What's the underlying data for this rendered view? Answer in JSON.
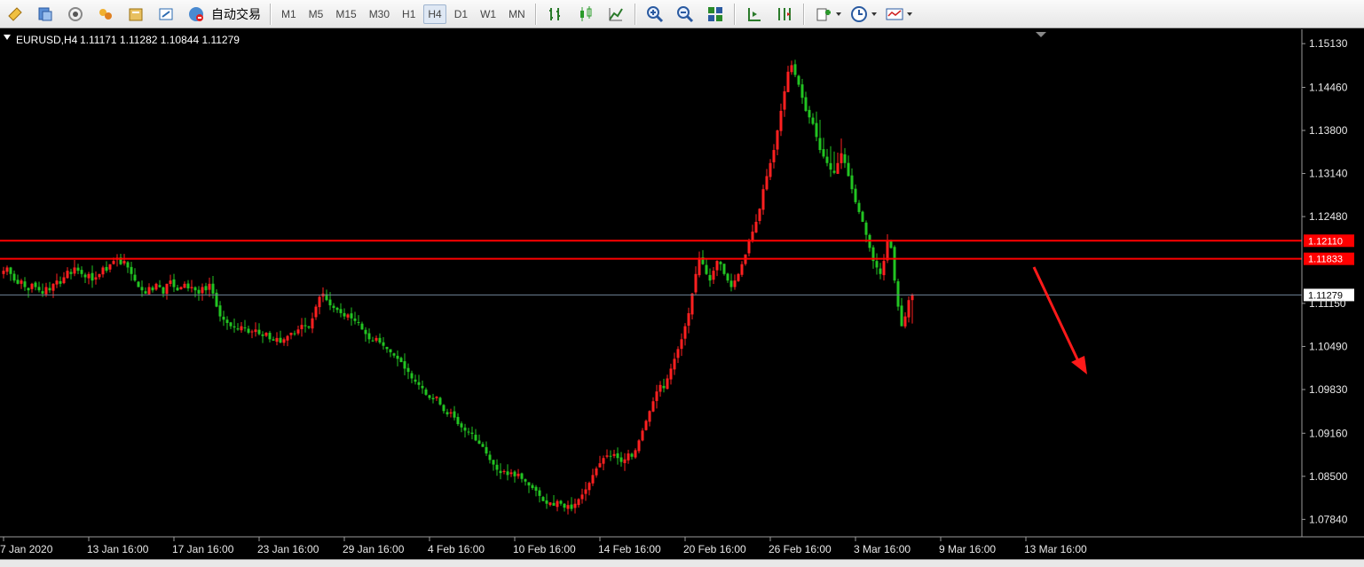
{
  "toolbar": {
    "auto_trade_label": "自动交易",
    "timeframes": [
      "M1",
      "M5",
      "M15",
      "M30",
      "H1",
      "H4",
      "D1",
      "W1",
      "MN"
    ],
    "active_timeframe": "H4"
  },
  "chart_data": {
    "type": "candlestick",
    "symbol": "EURUSD,H4",
    "ohlc_header": "1.11171 1.11282 1.10844 1.11279",
    "y_ticks": [
      1.1513,
      1.1446,
      1.138,
      1.1314,
      1.1248,
      1.1115,
      1.1049,
      1.0983,
      1.0916,
      1.085,
      1.0784
    ],
    "y_tick_labels": [
      "1.15130",
      "1.14460",
      "1.13800",
      "1.13140",
      "1.12480",
      "1.11150",
      "1.10490",
      "1.09830",
      "1.09160",
      "1.08500",
      "1.07840"
    ],
    "ylim": [
      1.076,
      1.1535
    ],
    "x_tick_labels": [
      "7 Jan 2020",
      "13 Jan 16:00",
      "17 Jan 16:00",
      "23 Jan 16:00",
      "29 Jan 16:00",
      "4 Feb 16:00",
      "10 Feb 16:00",
      "14 Feb 16:00",
      "20 Feb 16:00",
      "26 Feb 16:00",
      "3 Mar 16:00",
      "9 Mar 16:00",
      "13 Mar 16:00"
    ],
    "x_tick_bar_index": [
      0,
      24,
      48,
      72,
      96,
      120,
      144,
      168,
      192,
      216,
      240,
      264,
      288
    ],
    "closes": [
      1.1165,
      1.117,
      1.116,
      1.115,
      1.1145,
      1.115,
      1.114,
      1.1135,
      1.1145,
      1.114,
      1.1135,
      1.113,
      1.114,
      1.1135,
      1.1145,
      1.115,
      1.1145,
      1.1155,
      1.1165,
      1.116,
      1.117,
      1.1165,
      1.116,
      1.1155,
      1.116,
      1.115,
      1.1155,
      1.116,
      1.117,
      1.1165,
      1.1175,
      1.118,
      1.1185,
      1.1175,
      1.118,
      1.117,
      1.116,
      1.115,
      1.114,
      1.1135,
      1.113,
      1.114,
      1.1135,
      1.1145,
      1.114,
      1.113,
      1.1145,
      1.115,
      1.114,
      1.1135,
      1.114,
      1.1145,
      1.1138,
      1.114,
      1.1135,
      1.113,
      1.114,
      1.1135,
      1.1145,
      1.113,
      1.111,
      1.1095,
      1.109,
      1.1085,
      1.108,
      1.1078,
      1.1075,
      1.108,
      1.1078,
      1.107,
      1.1072,
      1.1075,
      1.1068,
      1.1065,
      1.107,
      1.106,
      1.1058,
      1.1062,
      1.1055,
      1.106,
      1.1065,
      1.107,
      1.1068,
      1.1075,
      1.1082,
      1.108,
      1.1078,
      1.1092,
      1.111,
      1.1125,
      1.113,
      1.112,
      1.1112,
      1.1108,
      1.1105,
      1.11,
      1.1095,
      1.1098,
      1.1092,
      1.1088,
      1.1085,
      1.1075,
      1.1068,
      1.106,
      1.1058,
      1.1062,
      1.1055,
      1.105,
      1.1045,
      1.104,
      1.1035,
      1.103,
      1.1025,
      1.1015,
      1.101,
      1.1,
      1.0995,
      1.099,
      1.0985,
      1.0975,
      1.097,
      1.0968,
      1.0972,
      1.096,
      1.095,
      1.0945,
      1.0948,
      1.094,
      1.093,
      1.0925,
      1.092,
      1.0918,
      1.0915,
      1.0905,
      1.09,
      1.0895,
      1.0885,
      1.0875,
      1.0868,
      1.086,
      1.0855,
      1.0858,
      1.0852,
      1.0856,
      1.085,
      1.0854,
      1.0846,
      1.0842,
      1.0836,
      1.0832,
      1.0828,
      1.082,
      1.0812,
      1.0808,
      1.081,
      1.0805,
      1.0812,
      1.0808,
      1.0802,
      1.0806,
      1.08,
      1.0808,
      1.0815,
      1.0822,
      1.083,
      1.084,
      1.0852,
      1.0862,
      1.087,
      1.0878,
      1.0882,
      1.088,
      1.0884,
      1.0878,
      1.0872,
      1.0876,
      1.0885,
      1.088,
      1.089,
      1.0905,
      1.092,
      1.0935,
      1.095,
      1.0965,
      1.098,
      1.099,
      1.0985,
      1.1,
      1.1015,
      1.103,
      1.1045,
      1.106,
      1.108,
      1.11,
      1.113,
      1.116,
      1.1185,
      1.1175,
      1.116,
      1.115,
      1.1165,
      1.118,
      1.1175,
      1.116,
      1.115,
      1.114,
      1.115,
      1.116,
      1.1175,
      1.119,
      1.121,
      1.1225,
      1.124,
      1.126,
      1.129,
      1.131,
      1.133,
      1.135,
      1.138,
      1.141,
      1.144,
      1.147,
      1.148,
      1.1465,
      1.145,
      1.143,
      1.141,
      1.14,
      1.139,
      1.137,
      1.135,
      1.134,
      1.133,
      1.132,
      1.1315,
      1.133,
      1.1345,
      1.133,
      1.131,
      1.129,
      1.127,
      1.1255,
      1.124,
      1.122,
      1.12,
      1.118,
      1.117,
      1.116,
      1.118,
      1.121,
      1.12,
      1.115,
      1.111,
      1.108,
      1.1095,
      1.112,
      1.1128
    ],
    "hlines": [
      {
        "label": "1.12110",
        "value": 1.1211,
        "color": "#ff0000"
      },
      {
        "label": "1.11833",
        "value": 1.11833,
        "color": "#ff0000"
      },
      {
        "label": "1.11279",
        "value": 1.11279,
        "color": "#6f8297"
      }
    ],
    "up_color": "#ff2020",
    "down_color": "#22c422",
    "annotation": {
      "type": "arrow",
      "color": "#ff1a1a",
      "direction": "down"
    }
  }
}
